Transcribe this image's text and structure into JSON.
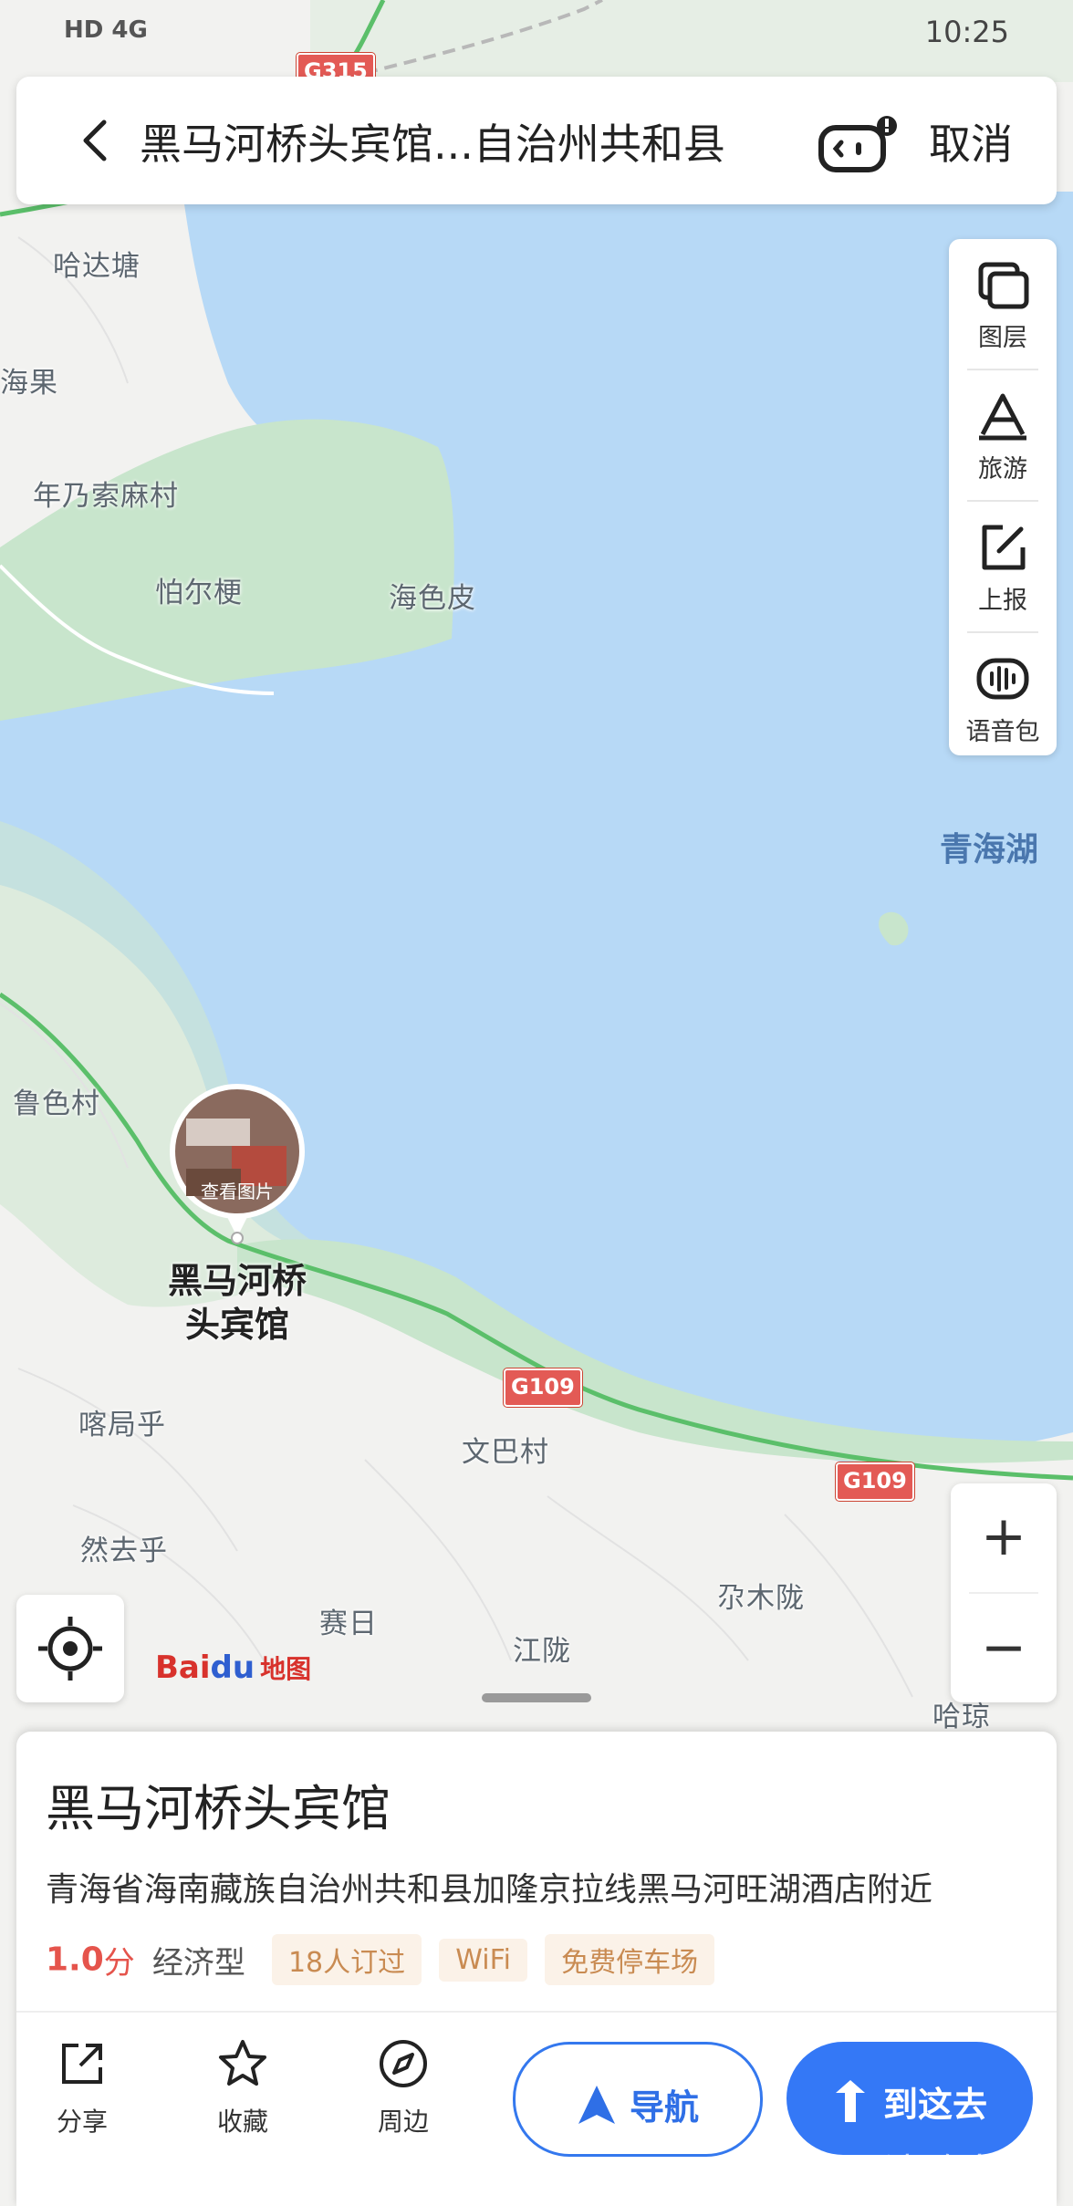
{
  "status_bar": {
    "left": "HD 4G",
    "time": "10:25"
  },
  "search": {
    "query": "黑马河桥头宾馆...自治州共和县",
    "cancel_label": "取消"
  },
  "toolbar": {
    "items": [
      {
        "label": "图层",
        "icon": "layers-icon"
      },
      {
        "label": "旅游",
        "icon": "travel-icon"
      },
      {
        "label": "上报",
        "icon": "report-icon"
      },
      {
        "label": "语音包",
        "icon": "voice-pack-icon"
      }
    ]
  },
  "map": {
    "labels": [
      "哈达塘",
      "海果",
      "年乃索麻村",
      "怕尔梗",
      "海色皮",
      "鲁色村",
      "喀局乎",
      "文巴村",
      "然去乎",
      "尕木陇",
      "赛日",
      "江陇",
      "哈琼"
    ],
    "lake_label": "青海湖",
    "roads": [
      "G315",
      "G109",
      "G109"
    ],
    "pin": {
      "photo_label": "查看图片",
      "title_line1": "黑马河桥",
      "title_line2": "头宾馆"
    },
    "zoom_in": "+",
    "zoom_out": "−",
    "logo": {
      "bai": "Bai",
      "du": "du",
      "suffix": "地图"
    }
  },
  "place": {
    "name": "黑马河桥头宾馆",
    "address": "青海省海南藏族自治州共和县加隆京拉线黑马河旺湖酒店附近",
    "score": "1.0",
    "score_unit": "分",
    "type": "经济型",
    "tags": [
      "18人订过",
      "WiFi",
      "免费停车场"
    ]
  },
  "actions": {
    "share": "分享",
    "favorite": "收藏",
    "nearby": "周边",
    "navigate": "导航",
    "go_here": "到这去"
  },
  "watermark": "清歌中国"
}
